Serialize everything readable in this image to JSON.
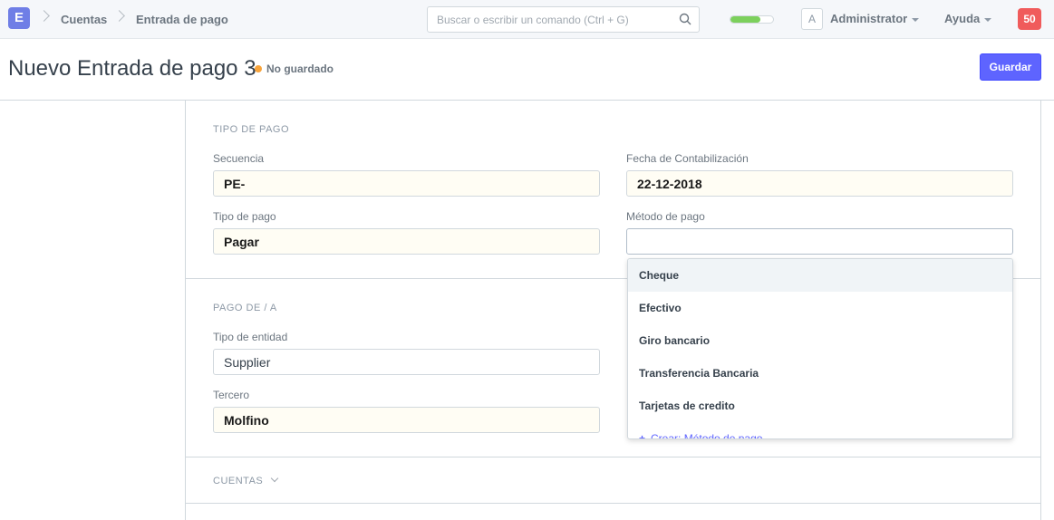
{
  "navbar": {
    "logo_letter": "E",
    "breadcrumbs": [
      "Cuentas",
      "Entrada de pago"
    ],
    "search_placeholder": "Buscar o escribir un comando (Ctrl + G)",
    "progress_fraction": 0.7,
    "avatar_letter": "A",
    "user_menu": "Administrator",
    "help_menu": "Ayuda",
    "notification_count": "50"
  },
  "page": {
    "title": "Nuevo Entrada de pago 3",
    "status": "No guardado",
    "save_label": "Guardar"
  },
  "sections": {
    "tipo_de_pago": {
      "heading": "TIPO DE PAGO",
      "secuencia_label": "Secuencia",
      "secuencia_value": "PE-",
      "fecha_label": "Fecha de Contabilización",
      "fecha_value": "22-12-2018",
      "tipo_pago_label": "Tipo de pago",
      "tipo_pago_value": "Pagar",
      "metodo_label": "Método de pago",
      "metodo_value": ""
    },
    "pago_de_a": {
      "heading": "PAGO DE / A",
      "tipo_entidad_label": "Tipo de entidad",
      "tipo_entidad_value": "Supplier",
      "tercero_label": "Tercero",
      "tercero_value": "Molfino"
    },
    "cuentas": {
      "heading": "CUENTAS"
    }
  },
  "dropdown": {
    "options": [
      "Cheque",
      "Efectivo",
      "Giro bancario",
      "Transferencia Bancaria",
      "Tarjetas de credito"
    ],
    "create_label": "Crear: Método de pago"
  },
  "colors": {
    "accent": "#5e64ff",
    "logo": "#6f7ee6",
    "notification": "#f05b5b",
    "unsaved_dot": "#f8a43c",
    "progress": "#7cd05c"
  }
}
